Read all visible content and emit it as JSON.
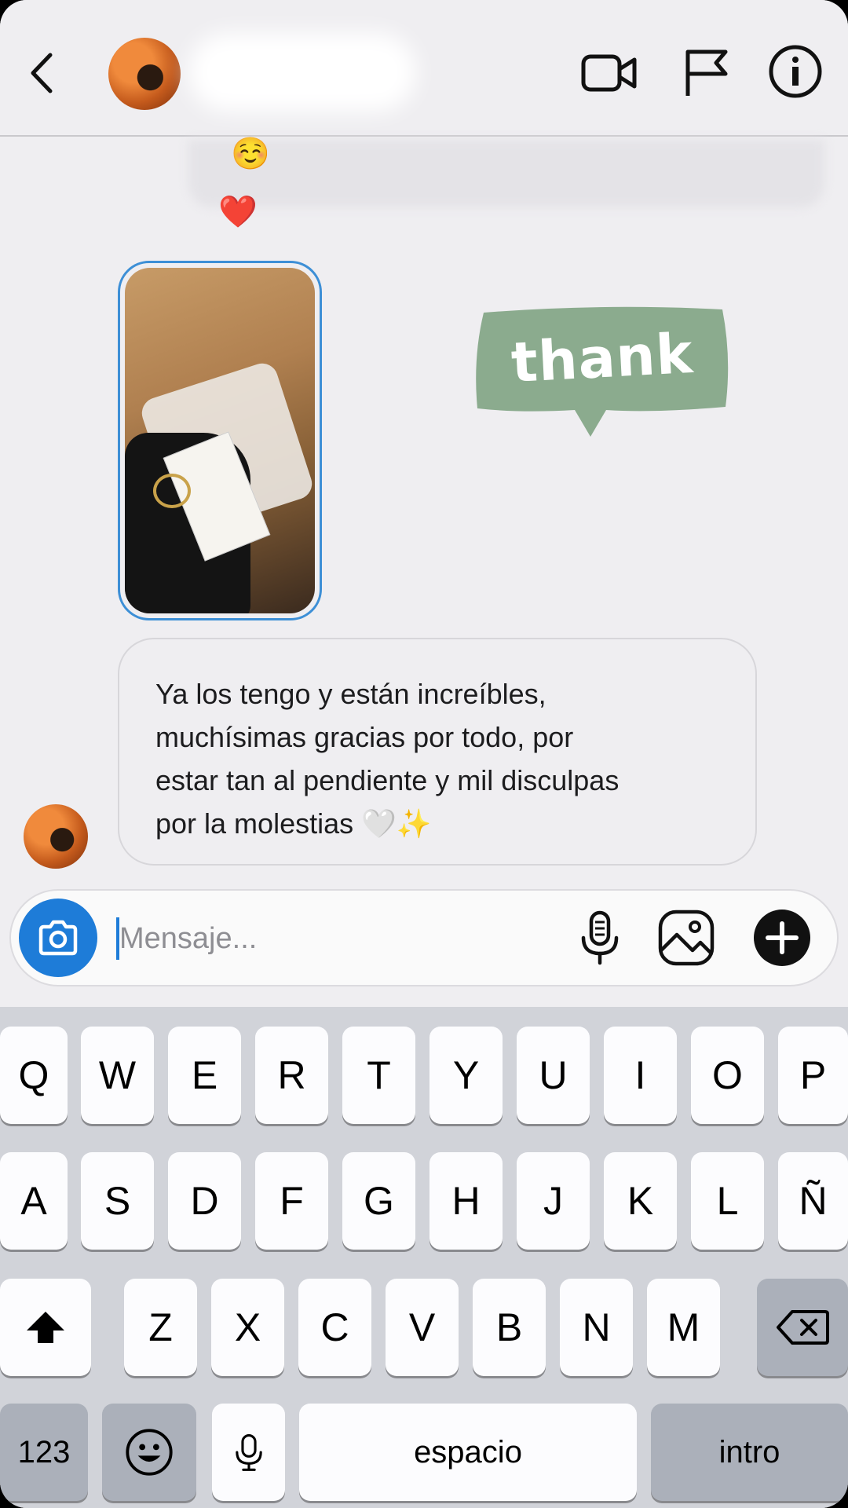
{
  "header": {
    "back_icon": "chevron-left-icon",
    "video_icon": "video-camera-icon",
    "report_icon": "flag-icon",
    "info_icon": "info-icon"
  },
  "chat": {
    "reactions": [
      "☺️",
      "❤️"
    ],
    "sticker_text": "thank",
    "sticker_color": "#8bab8e",
    "message_lines": [
      "Ya los tengo y están increíbles,",
      "muchísimas gracias por todo, por",
      "estar tan al pendiente y mil disculpas",
      "por la molestias 🤍✨"
    ]
  },
  "composer": {
    "placeholder": "Mensaje...",
    "camera_color": "#1e7cd8",
    "icons": [
      "camera-icon",
      "microphone-icon",
      "gallery-icon",
      "plus-icon"
    ]
  },
  "keyboard": {
    "row1": [
      "Q",
      "W",
      "E",
      "R",
      "T",
      "Y",
      "U",
      "I",
      "O",
      "P"
    ],
    "row2": [
      "A",
      "S",
      "D",
      "F",
      "G",
      "H",
      "J",
      "K",
      "L",
      "Ñ"
    ],
    "row3": [
      "Z",
      "X",
      "C",
      "V",
      "B",
      "N",
      "M"
    ],
    "numbers_label": "123",
    "space_label": "espacio",
    "return_label": "intro"
  }
}
